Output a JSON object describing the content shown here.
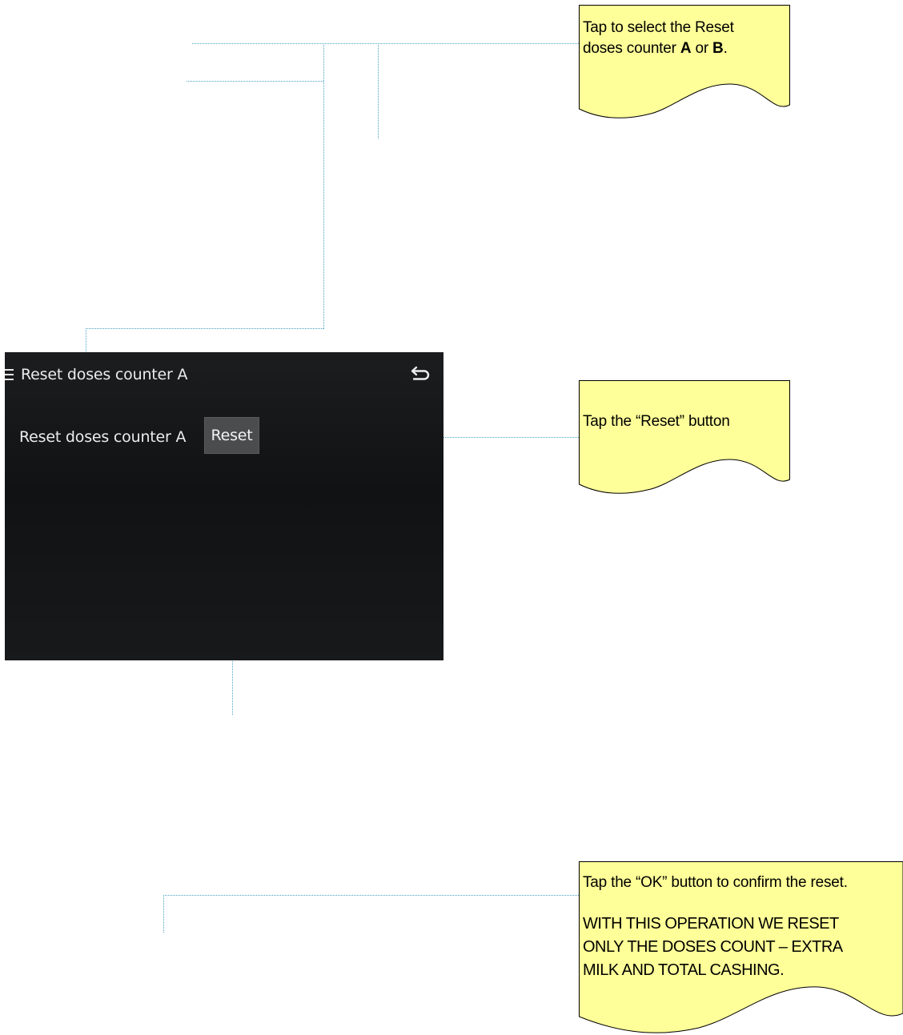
{
  "screen": {
    "title": "Reset doses counter A",
    "row_label": "Reset doses counter A",
    "reset_button": "Reset",
    "menu_icon": "hamburger-menu-icon",
    "back_icon": "back-arrow-icon",
    "colors": {
      "background": "#121416",
      "button": "#4b4c4e",
      "text": "#ececec"
    }
  },
  "notes": {
    "select_counter": {
      "text_1": "Tap to select the Reset",
      "text_2": "doses counter ",
      "bold_a": "A",
      "text_or": " or ",
      "bold_b": "B",
      "text_end": "."
    },
    "tap_reset": {
      "text": "Tap the “Reset” button"
    },
    "confirm": {
      "line_1": "Tap the “OK” button to confirm the reset.",
      "warning_1": "WITH THIS OPERATION WE RESET",
      "warning_2": "ONLY THE DOSES COUNT – EXTRA",
      "warning_3": "MILK AND TOTAL CASHING."
    },
    "colors": {
      "note_fill": "#ffff99",
      "leader_line": "#4aa3c8"
    }
  }
}
